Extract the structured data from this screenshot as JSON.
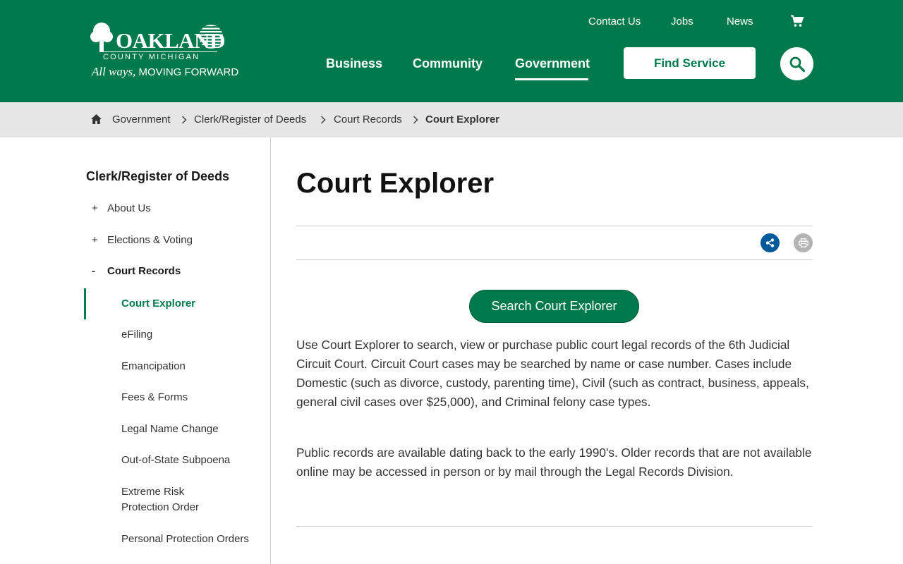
{
  "colors": {
    "brand_green": "#007a4d",
    "share_blue": "#005a9c",
    "breadcrumb_bg": "#e6e6e6"
  },
  "logo": {
    "wordmark": "OAKLAND",
    "county": "COUNTY MICHIGAN",
    "tagline_script": "All ways,",
    "tagline": "MOVING FORWARD",
    "icon": "tree-logo-icon"
  },
  "utility_nav": {
    "contact": "Contact Us",
    "jobs": "Jobs",
    "news": "News",
    "cart_icon": "cart-icon"
  },
  "main_nav": {
    "business": "Business",
    "community": "Community",
    "government": "Government",
    "active": "Government",
    "find_service": "Find Service",
    "search_icon": "search-icon"
  },
  "breadcrumb": {
    "home_icon": "home-icon",
    "items": [
      "Government",
      "Clerk/Register of Deeds",
      "Court Records",
      "Court Explorer"
    ]
  },
  "sidebar": {
    "title": "Clerk/Register of Deeds",
    "sections": [
      {
        "toggle": "+",
        "label": "About Us"
      },
      {
        "toggle": "+",
        "label": "Elections & Voting"
      },
      {
        "toggle": "-",
        "label": "Court Records"
      }
    ],
    "subitems": [
      {
        "label": "Court Explorer",
        "active": true
      },
      {
        "label": "eFiling"
      },
      {
        "label": "Emancipation"
      },
      {
        "label": "Fees & Forms"
      },
      {
        "label": "Legal Name Change"
      },
      {
        "label": "Out-of-State Subpoena"
      },
      {
        "label": "Extreme Risk Protection Order"
      },
      {
        "label": "Personal Protection Orders"
      }
    ]
  },
  "main": {
    "title": "Court Explorer",
    "share_icon": "share-icon",
    "print_icon": "print-icon",
    "cta": "Search Court Explorer",
    "paragraphs": [
      "Use Court Explorer to search, view or purchase public court legal records of the 6th Judicial Circuit Court. Circuit Court cases may be searched by name or case number. Cases include Domestic (such as divorce, custody, parenting time), Civil (such as contract, business, appeals, general civil cases over $25,000), and Criminal felony case types.",
      "Public records are available dating back to the early 1990's. Older records that are not available online may be accessed in person or by mail through the Legal Records Division."
    ]
  }
}
